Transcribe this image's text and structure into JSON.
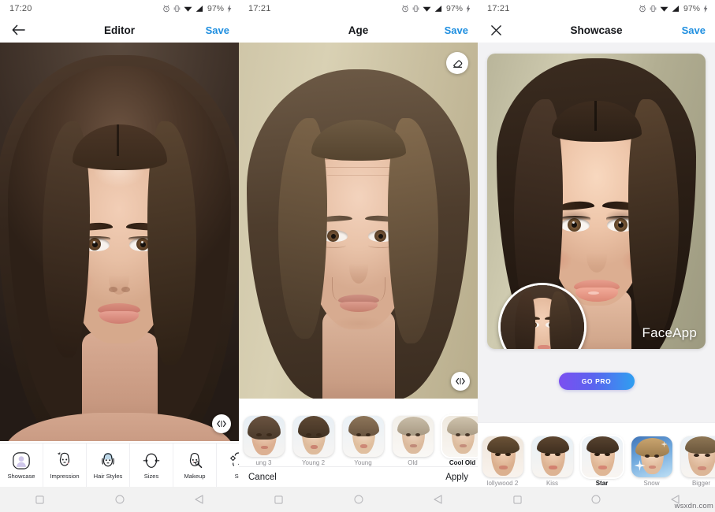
{
  "panels": [
    {
      "id": "editor",
      "status": {
        "time": "17:20",
        "battery": "97%"
      },
      "appbar": {
        "title": "Editor",
        "action": "Save",
        "nav_icon": "back-arrow-icon"
      },
      "tools": [
        {
          "label": "Showcase",
          "icon": "showcase-icon",
          "selected": true
        },
        {
          "label": "Impression",
          "icon": "impression-icon",
          "selected": false
        },
        {
          "label": "Hair Styles",
          "icon": "hair-styles-icon",
          "selected": false
        },
        {
          "label": "Sizes",
          "icon": "sizes-icon",
          "selected": false
        },
        {
          "label": "Makeup",
          "icon": "makeup-icon",
          "selected": false
        },
        {
          "label": "Sk",
          "icon": "skin-icon",
          "selected": false
        }
      ],
      "compare_handle": "compare-slider-handle"
    },
    {
      "id": "age",
      "status": {
        "time": "17:21",
        "battery": "97%"
      },
      "appbar": {
        "title": "Age",
        "action": "Save",
        "nav_icon": "none"
      },
      "eraser": "eraser-icon",
      "filters": [
        {
          "label": "ung 3",
          "selected": false
        },
        {
          "label": "Young 2",
          "selected": false
        },
        {
          "label": "Young",
          "selected": false
        },
        {
          "label": "Old",
          "selected": false
        },
        {
          "label": "Cool Old",
          "selected": true
        }
      ],
      "cancel": "Cancel",
      "apply": "Apply",
      "compare_handle": "compare-slider-handle"
    },
    {
      "id": "showcase",
      "status": {
        "time": "17:21",
        "battery": "97%"
      },
      "appbar": {
        "title": "Showcase",
        "action": "Save",
        "nav_icon": "close-icon"
      },
      "watermark": "FaceApp",
      "gopro": "GO PRO",
      "filters": [
        {
          "label": "lollywood 2",
          "selected": false
        },
        {
          "label": "Kiss",
          "selected": false
        },
        {
          "label": "Star",
          "selected": true
        },
        {
          "label": "Snow",
          "selected": false
        },
        {
          "label": "Bigger",
          "selected": false
        }
      ]
    }
  ],
  "navbar": {
    "recent": "square-recents-icon",
    "home": "circle-home-icon",
    "back": "triangle-back-icon"
  },
  "watermark_site": "wsxdn.com",
  "colors": {
    "accent": "#1f8fe0",
    "pro_start": "#7b4ff0",
    "pro_end": "#2f9ff0",
    "title": "#14161a"
  }
}
